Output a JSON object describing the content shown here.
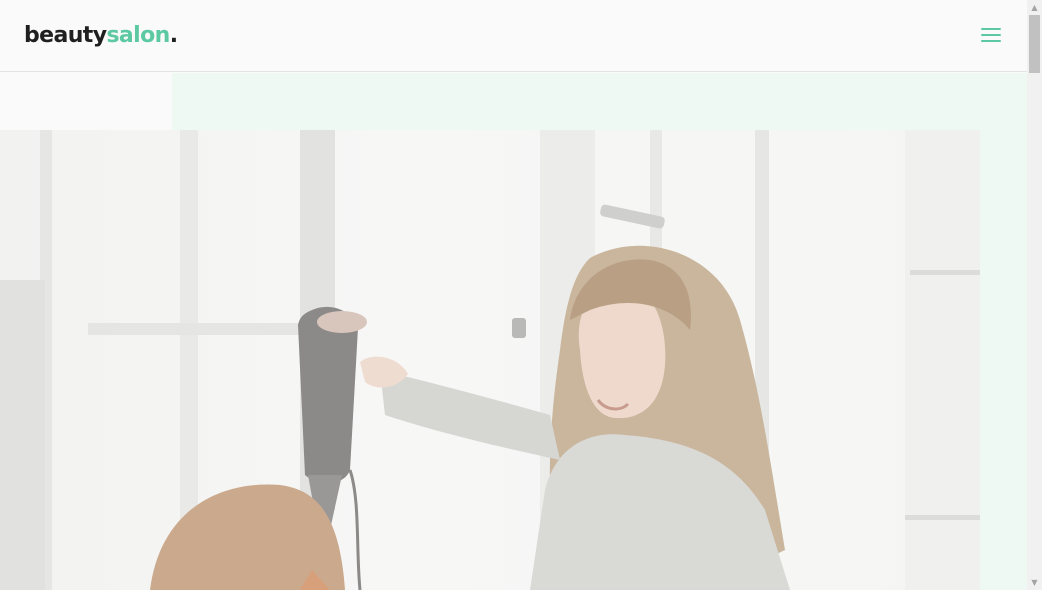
{
  "header": {
    "logo": {
      "part_a": "beauty",
      "part_b": "salon",
      "part_c": "."
    },
    "menu_icon": "hamburger-menu-icon"
  },
  "hero": {
    "image": "hairdresser-blow-drying-client-photo"
  },
  "colors": {
    "accent": "#5cc9a2",
    "mint_bg": "#eef9f4",
    "text_dark": "#1f1f1f"
  },
  "scrollbar": {
    "up_arrow": "▲",
    "down_arrow": "▼"
  }
}
